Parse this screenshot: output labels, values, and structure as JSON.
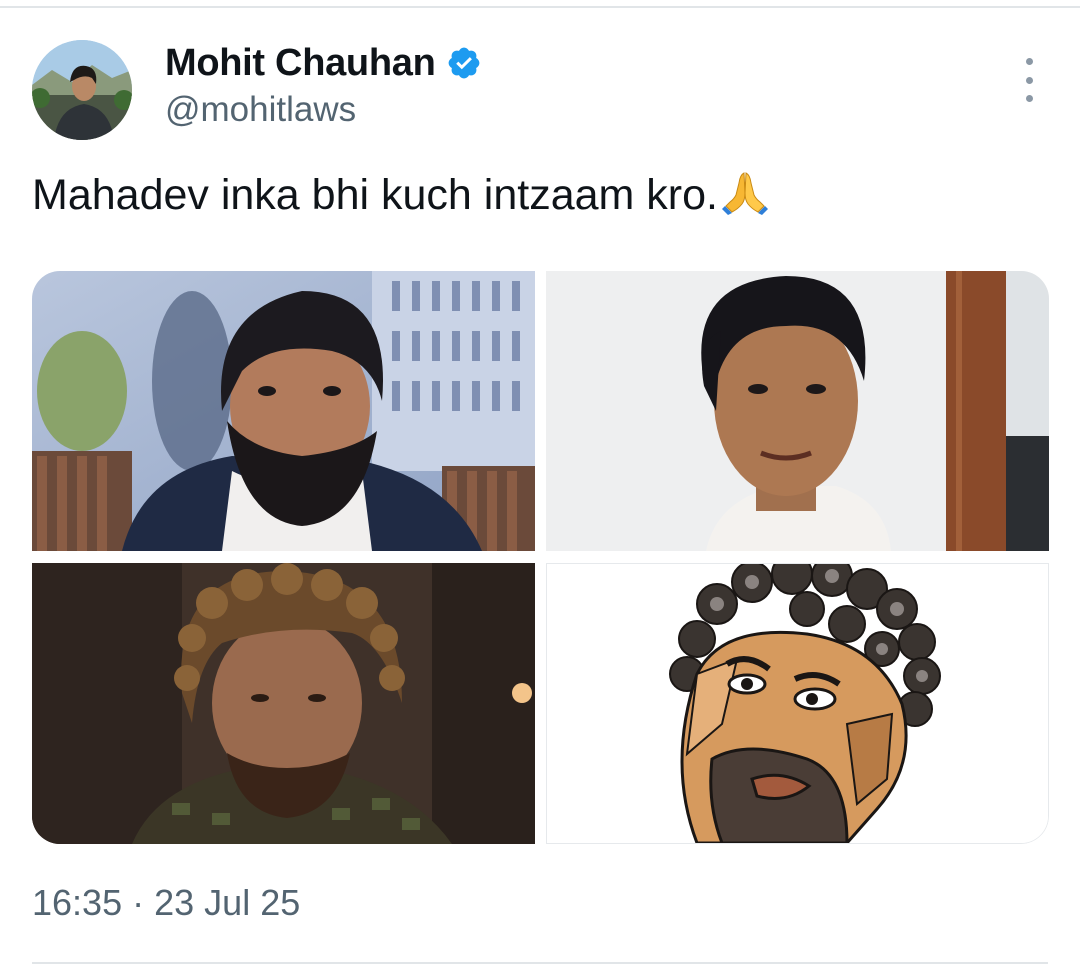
{
  "author": {
    "display_name": "Mohit Chauhan",
    "handle": "@mohitlaws",
    "verified": true
  },
  "tweet": {
    "text": "Mahadev inka bhi kuch intzaam kro.",
    "emoji": "🙏",
    "time": "16:35",
    "separator": "·",
    "date": "23 Jul 25"
  },
  "media": [
    {
      "kind": "photo",
      "description_icon": "photo-man-beard-outdoor"
    },
    {
      "kind": "photo",
      "description_icon": "photo-man-white-wall"
    },
    {
      "kind": "photo",
      "description_icon": "photo-man-curly-hair-dark"
    },
    {
      "kind": "illustration",
      "description_icon": "illustration-curly-hair-man"
    }
  ],
  "colors": {
    "text_primary": "#0f1419",
    "text_secondary": "#536471",
    "verified_blue": "#1d9bf0",
    "divider": "#e1e5e8"
  },
  "icons": {
    "verified": "verified-badge-icon",
    "more": "more-vertical-icon",
    "emoji": "folded-hands-icon"
  }
}
